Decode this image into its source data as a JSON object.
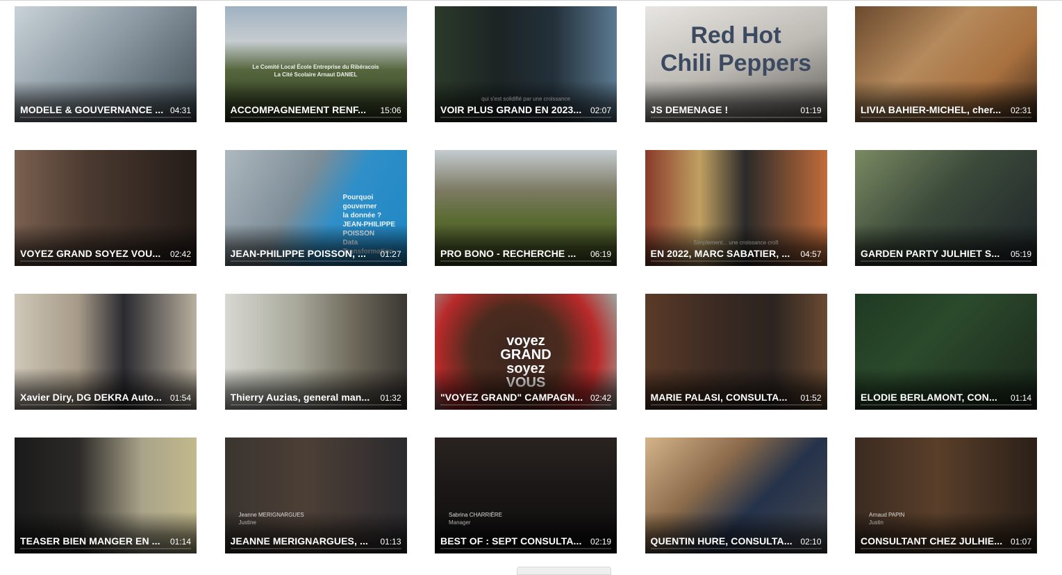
{
  "videos": [
    {
      "title": "MODELE & GOUVERNANCE ...",
      "duration": "04:31",
      "bg": "linear-gradient(135deg,#c9d2d8 0%,#8d9aa3 45%,#3e4a52 100%)",
      "overlay": []
    },
    {
      "title": "ACCOMPAGNEMENT RENF...",
      "duration": "15:06",
      "bg": "linear-gradient(180deg,#9fb2c2 0%,#c6ccd0 30%,#55663d 55%,#2e3a1f 100%)",
      "overlay": [
        "Le Comité Local École Entreprise du Ribéracois",
        "La Cité Scolaire Arnaut DANIEL"
      ]
    },
    {
      "title": "VOIR PLUS GRAND EN 2023...",
      "duration": "02:07",
      "bg": "linear-gradient(90deg,#2b3a2a 0%,#1c2424 35%,#23303a 65%,#5b7a90 100%)",
      "overlay": [
        "qui s'est solidifié par une croissance"
      ]
    },
    {
      "title": "JS DEMENAGE !",
      "duration": "01:19",
      "bg": "linear-gradient(160deg,#e8e6e2 0%,#bdbab4 50%,#5a5753 100%)",
      "overlay": [
        "Red Hot",
        "Chili Peppers"
      ]
    },
    {
      "title": "LIVIA BAHIER-MICHEL, cher...",
      "duration": "02:31",
      "bg": "linear-gradient(135deg,#6b4a2e 0%,#b58a5c 40%,#a8703f 70%,#3f2a1a 100%)",
      "overlay": []
    },
    {
      "title": "VOYEZ GRAND SOYEZ VOU...",
      "duration": "02:42",
      "bg": "linear-gradient(90deg,#7a6050 0%,#4b3a30 40%,#241c18 100%)",
      "overlay": []
    },
    {
      "title": "JEAN-PHILIPPE POISSON, ...",
      "duration": "01:27",
      "bg": "linear-gradient(120deg,#aeb8bf 0%,#7d8d97 40%,#2f8fc8 60%,#1e86c4 100%)",
      "overlay": [
        "Pourquoi gouverner",
        "la donnée ?",
        "JEAN-PHILIPPE POISSON",
        "Data Transformation"
      ]
    },
    {
      "title": "PRO BONO - RECHERCHE ...",
      "duration": "06:19",
      "bg": "linear-gradient(180deg,#c4ccd0 0%,#7c7a62 35%,#5b6b33 60%,#3f4d22 100%)",
      "overlay": []
    },
    {
      "title": "EN 2022, MARC SABATIER, ...",
      "duration": "04:57",
      "bg": "linear-gradient(90deg,#8a3a2a 0%,#c0a062 30%,#2a2a2a 55%,#c26c3a 100%)",
      "overlay": [
        "Simplement... une croissance croît"
      ]
    },
    {
      "title": "GARDEN PARTY JULHIET S...",
      "duration": "05:19",
      "bg": "linear-gradient(135deg,#7a8a62 0%,#3b4a3a 45%,#1d2228 100%)",
      "overlay": []
    },
    {
      "title": "Xavier Diry, DG DEKRA Auto...",
      "duration": "01:54",
      "bg": "linear-gradient(90deg,#cfc7b8 0%,#a69a87 35%,#2a2a30 60%,#b9b09e 100%)",
      "overlay": []
    },
    {
      "title": "Thierry Auzias, general man...",
      "duration": "01:32",
      "bg": "linear-gradient(90deg,#d8d8d2 0%,#a7a89a 40%,#6f6a5c 70%,#3a3632 100%)",
      "overlay": []
    },
    {
      "title": "\"VOYEZ GRAND\" CAMPAGN...",
      "duration": "02:42",
      "bg": "radial-gradient(circle at 45% 50%,#3a2620 0%,#4c2b1e 40%,#b82a2a 70%,#9aa7a0 100%)",
      "overlay": [
        "voyez",
        "GRAND",
        "soyez",
        "VOUS"
      ]
    },
    {
      "title": "MARIE PALASI, CONSULTA...",
      "duration": "01:52",
      "bg": "linear-gradient(90deg,#5b3a28 0%,#3a2a22 40%,#2b2420 70%,#6a4a32 100%)",
      "overlay": []
    },
    {
      "title": "ELODIE BERLAMONT, CON...",
      "duration": "01:14",
      "bg": "linear-gradient(135deg,#1f3a22 0%,#2b4a2c 40%,#1a261a 100%)",
      "overlay": []
    },
    {
      "title": "TEASER BIEN MANGER EN ...",
      "duration": "01:14",
      "bg": "linear-gradient(90deg,#1a1a1a 0%,#2c2a28 35%,#a9a38a 70%,#c2b98c 100%)",
      "overlay": []
    },
    {
      "title": "JEANNE MERIGNARGUES, ...",
      "duration": "01:13",
      "bg": "linear-gradient(90deg,#3a3430 0%,#4c3f36 45%,#2b2a2e 100%)",
      "overlay": [
        "Jeanne MERIGNARGUES",
        "Justine"
      ]
    },
    {
      "title": "BEST OF : SEPT CONSULTA...",
      "duration": "02:19",
      "bg": "linear-gradient(180deg,#2a2320 0%,#1a1716 45%,#0e0d0d 100%)",
      "overlay": [
        "Sabrina CHARRIÈRE",
        "Manager"
      ]
    },
    {
      "title": "QUENTIN HURE, CONSULTA...",
      "duration": "02:10",
      "bg": "linear-gradient(135deg,#d4b48a 0%,#8a6a4a 35%,#24324a 60%,#4a4c50 100%)",
      "overlay": []
    },
    {
      "title": "CONSULTANT CHEZ JULHIE...",
      "duration": "01:07",
      "bg": "linear-gradient(90deg,#3a2a20 0%,#5a3f2a 45%,#2b2018 100%)",
      "overlay": [
        "Arnaud PAPIN",
        "Justin"
      ]
    }
  ]
}
